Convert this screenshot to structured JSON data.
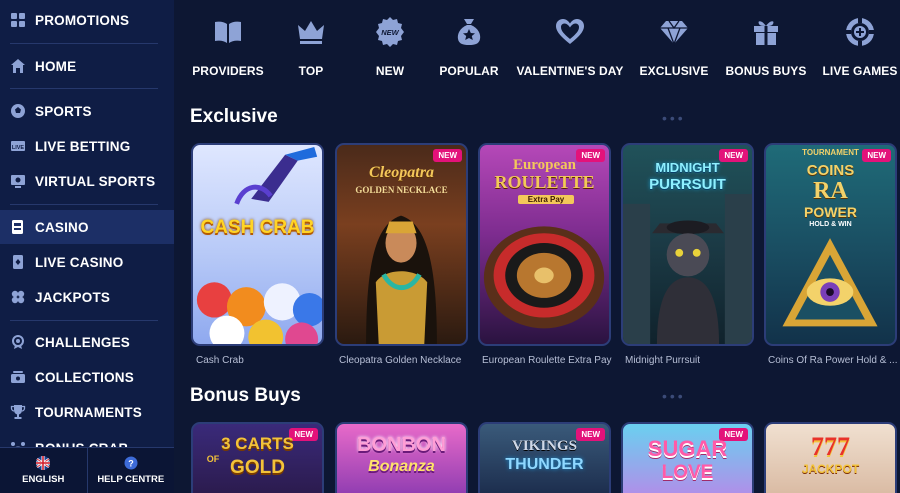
{
  "sidebar": {
    "items": [
      {
        "label": "PROMOTIONS",
        "icon": "gift-grid-icon"
      },
      {
        "label": "HOME",
        "icon": "home-icon"
      },
      {
        "label": "SPORTS",
        "icon": "football-icon"
      },
      {
        "label": "LIVE BETTING",
        "icon": "live-icon"
      },
      {
        "label": "VIRTUAL SPORTS",
        "icon": "monitor-icon"
      },
      {
        "label": "CASINO",
        "icon": "casino-icon"
      },
      {
        "label": "LIVE CASINO",
        "icon": "card-icon"
      },
      {
        "label": "JACKPOTS",
        "icon": "clover-icon"
      },
      {
        "label": "CHALLENGES",
        "icon": "medal-icon"
      },
      {
        "label": "COLLECTIONS",
        "icon": "collection-icon"
      },
      {
        "label": "TOURNAMENTS",
        "icon": "trophy-icon"
      },
      {
        "label": "BONUS CRAB",
        "icon": "crab-icon"
      }
    ],
    "active_index": 5,
    "footer": {
      "language": "ENGLISH",
      "help": "HELP CENTRE"
    }
  },
  "categories": [
    {
      "label": "PROVIDERS",
      "icon": "book-icon"
    },
    {
      "label": "TOP",
      "icon": "crown-icon"
    },
    {
      "label": "NEW",
      "icon": "new-seal-icon",
      "icon_text": "NEW"
    },
    {
      "label": "POPULAR",
      "icon": "money-bag-icon"
    },
    {
      "label": "VALENTINE'S DAY",
      "icon": "heart-icon"
    },
    {
      "label": "EXCLUSIVE",
      "icon": "diamond-icon"
    },
    {
      "label": "BONUS BUYS",
      "icon": "gift-icon"
    },
    {
      "label": "LIVE GAMES",
      "icon": "chip-icon"
    }
  ],
  "sections": [
    {
      "title": "Exclusive",
      "games": [
        {
          "name": "Cash Crab",
          "new": false,
          "art_title": "CASH CRAB"
        },
        {
          "name": "Cleopatra Golden Necklace",
          "new": true,
          "art_title": "Cleopatra",
          "art_sub": "GOLDEN NECKLACE"
        },
        {
          "name": "European Roulette Extra Pay",
          "new": true,
          "art_title": "European",
          "art_sub": "ROULETTE",
          "art_tag": "Extra Pay"
        },
        {
          "name": "Midnight Purrsuit",
          "new": true,
          "art_title": "MIDNIGHT",
          "art_sub": "PURRSUIT"
        },
        {
          "name": "Coins Of Ra Power Hold & ...",
          "new": true,
          "art_top": "TOURNAMENT",
          "art_title": "COINS",
          "art_mid": "RA",
          "art_sub": "POWER",
          "art_tag": "HOLD & WIN"
        }
      ]
    },
    {
      "title": "Bonus Buys",
      "games": [
        {
          "name": "3 Carts of Gold",
          "new": true,
          "art_title": "3 CARTS",
          "art_sub": "GOLD",
          "art_of": "OF"
        },
        {
          "name": "Bonbon Bonanza",
          "new": false,
          "art_title": "BONBON",
          "art_sub": "Bonanza"
        },
        {
          "name": "Vikings Thunder",
          "new": true,
          "art_title": "VIKINGS",
          "art_sub": "THUNDER"
        },
        {
          "name": "Sugar Love",
          "new": true,
          "art_title": "SUGAR",
          "art_sub": "LOVE"
        },
        {
          "name": "777 Jackpot",
          "new": false,
          "art_title": "777",
          "art_sub": "JACKPOT"
        }
      ]
    }
  ],
  "badge_text": "NEW",
  "colors": {
    "accent": "#e3127a",
    "bg": "#0d1733",
    "sidebar": "#0f1d45",
    "icon": "#8ea3d6"
  }
}
